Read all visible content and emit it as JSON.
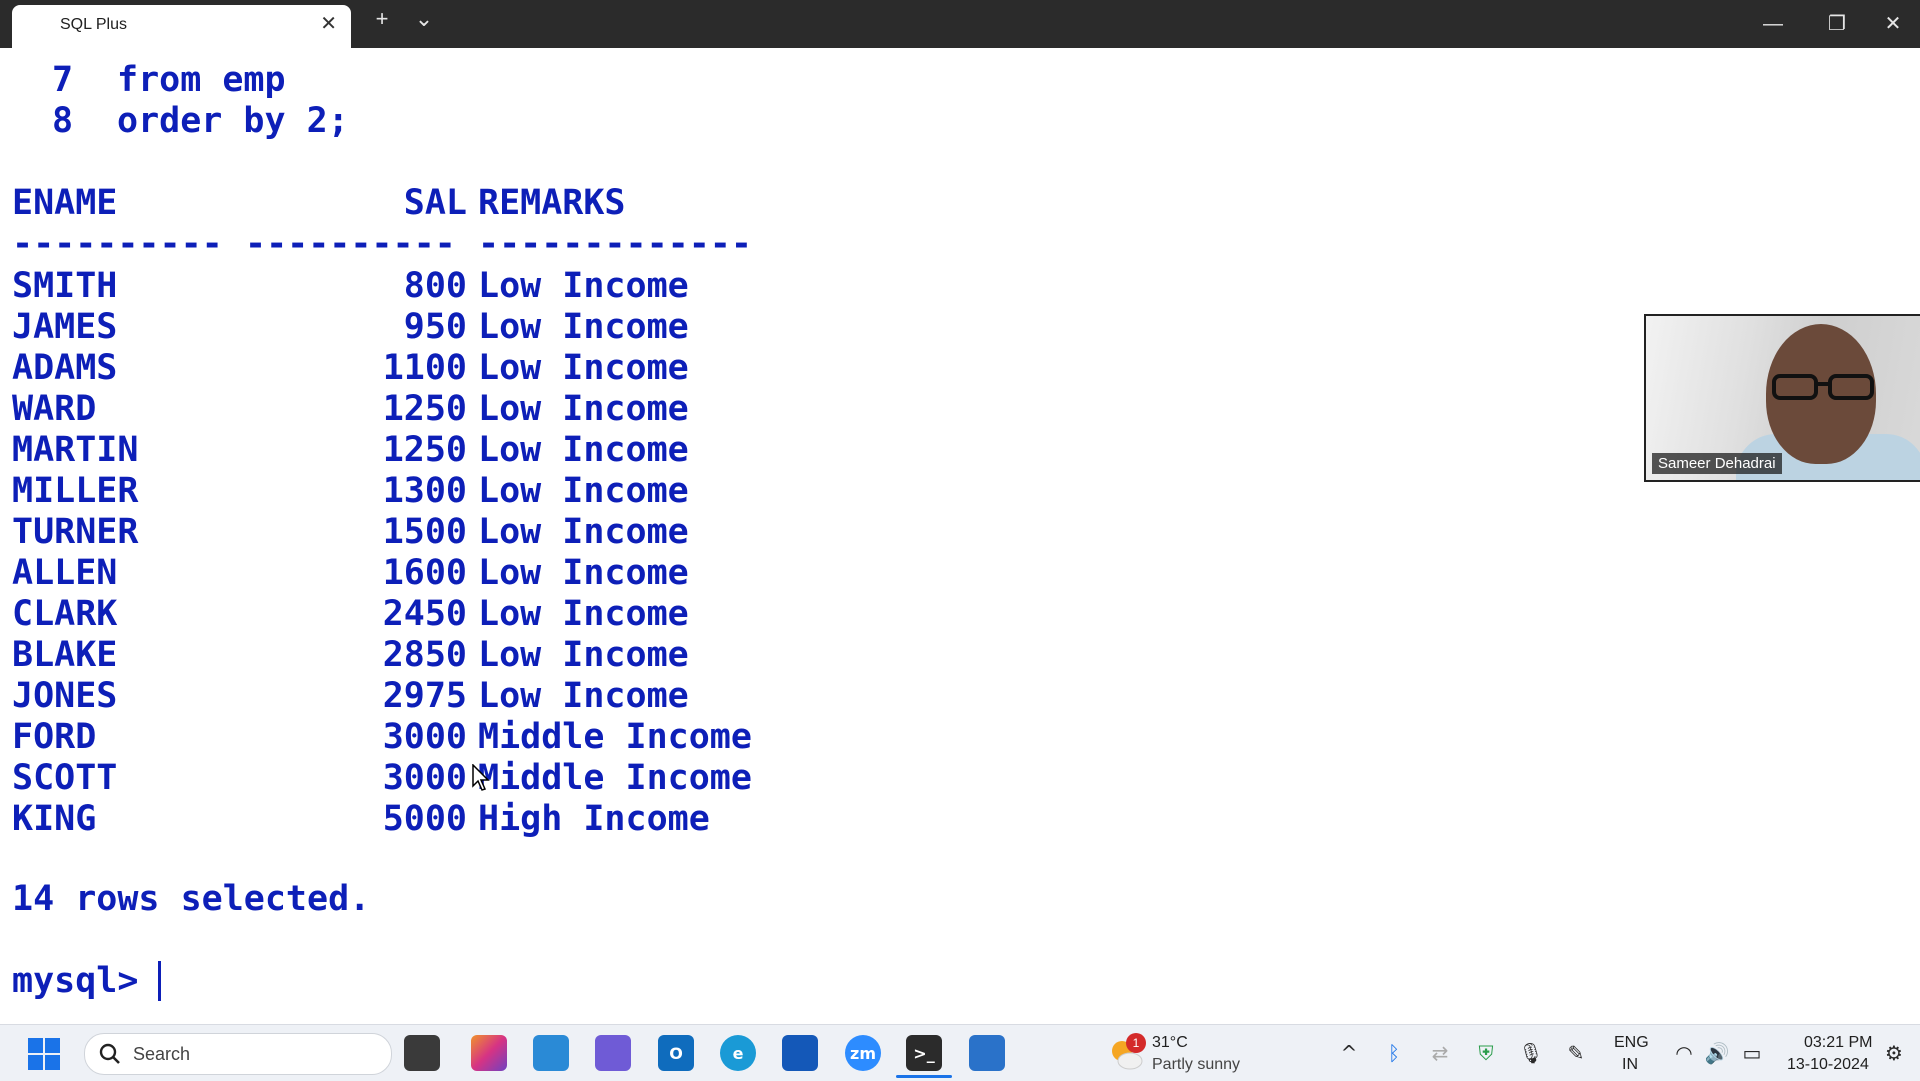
{
  "window": {
    "tab_title": "SQL Plus",
    "tab_close": "✕",
    "new_tab": "+",
    "tab_dropdown": "⌄",
    "minimize": "—",
    "restore": "❐",
    "close": "✕"
  },
  "terminal": {
    "query_lines": [
      {
        "num": "7",
        "text": "from emp"
      },
      {
        "num": "8",
        "text": "order by 2;"
      }
    ],
    "headers": {
      "ename": "ENAME",
      "sal": "SAL",
      "remarks": "REMARKS"
    },
    "separators": {
      "ename": "----------",
      "sal": "----------",
      "remarks": "-------------"
    },
    "rows": [
      {
        "ename": "SMITH",
        "sal": "800",
        "remarks": "Low Income"
      },
      {
        "ename": "JAMES",
        "sal": "950",
        "remarks": "Low Income"
      },
      {
        "ename": "ADAMS",
        "sal": "1100",
        "remarks": "Low Income"
      },
      {
        "ename": "WARD",
        "sal": "1250",
        "remarks": "Low Income"
      },
      {
        "ename": "MARTIN",
        "sal": "1250",
        "remarks": "Low Income"
      },
      {
        "ename": "MILLER",
        "sal": "1300",
        "remarks": "Low Income"
      },
      {
        "ename": "TURNER",
        "sal": "1500",
        "remarks": "Low Income"
      },
      {
        "ename": "ALLEN",
        "sal": "1600",
        "remarks": "Low Income"
      },
      {
        "ename": "CLARK",
        "sal": "2450",
        "remarks": "Low Income"
      },
      {
        "ename": "BLAKE",
        "sal": "2850",
        "remarks": "Low Income"
      },
      {
        "ename": "JONES",
        "sal": "2975",
        "remarks": "Low Income"
      },
      {
        "ename": "FORD",
        "sal": "3000",
        "remarks": "Middle Income"
      },
      {
        "ename": "SCOTT",
        "sal": "3000",
        "remarks": "Middle Income"
      },
      {
        "ename": "KING",
        "sal": "5000",
        "remarks": "High Income"
      }
    ],
    "summary": "14 rows selected.",
    "prompt": "mysql>",
    "text_color": "#0d1fb8"
  },
  "video": {
    "participant_name": "Sameer Dehadrai"
  },
  "taskbar": {
    "search_placeholder": "Search",
    "apps": [
      {
        "name": "file-explorer-icon",
        "glyph": ""
      },
      {
        "name": "copilot-icon",
        "glyph": ""
      },
      {
        "name": "desktop-icon",
        "glyph": ""
      },
      {
        "name": "teams-icon",
        "glyph": ""
      },
      {
        "name": "outlook-icon",
        "glyph": "O"
      },
      {
        "name": "edge-icon",
        "glyph": "e"
      },
      {
        "name": "mail-icon",
        "glyph": ""
      },
      {
        "name": "zoom-icon",
        "glyph": "zm"
      },
      {
        "name": "terminal-icon",
        "glyph": ">_"
      },
      {
        "name": "notepad-icon",
        "glyph": ""
      }
    ],
    "weather": {
      "badge": "1",
      "temp": "31°C",
      "desc": "Partly sunny"
    },
    "lang": {
      "line1": "ENG",
      "line2": "IN"
    },
    "clock": {
      "time": "03:21 PM",
      "date": "13-10-2024"
    }
  }
}
